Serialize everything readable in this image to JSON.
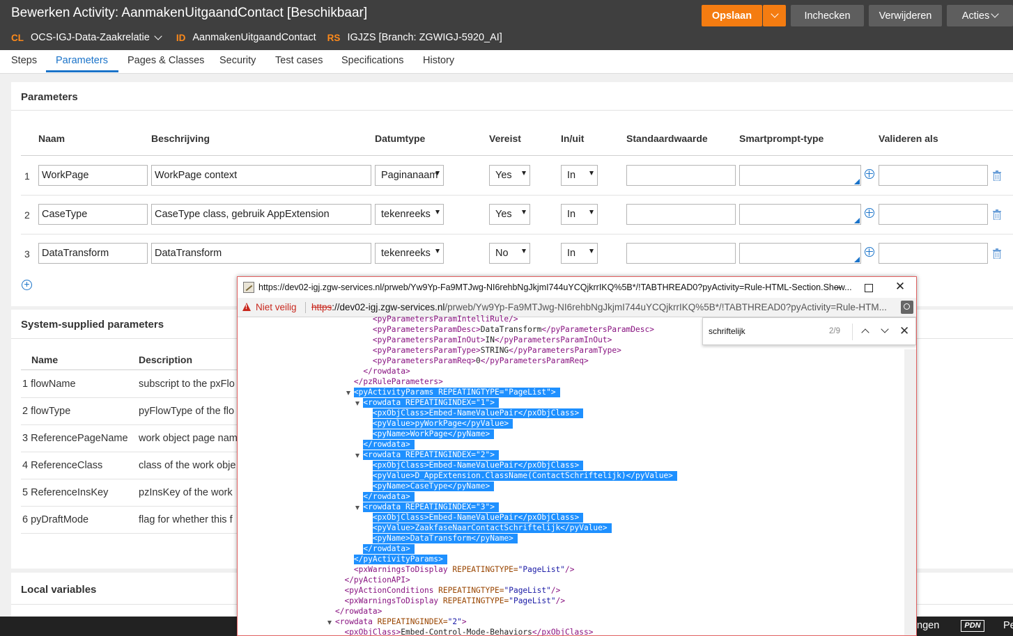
{
  "header": {
    "title": "Bewerken Activity: AanmakenUitgaandContact [Beschikbaar]",
    "cl_key": "CL",
    "cl_value": "OCS-IGJ-Data-Zaakrelatie",
    "id_key": "ID",
    "id_value": "AanmakenUitgaandContact",
    "rs_key": "RS",
    "rs_value": "IGJZS [Branch: ZGWIGJ-5920_AI]",
    "save_label": "Opslaan",
    "checkin_label": "Inchecken",
    "delete_label": "Verwijderen",
    "actions_label": "Acties"
  },
  "tabs": [
    "Steps",
    "Parameters",
    "Pages & Classes",
    "Security",
    "Test cases",
    "Specifications",
    "History"
  ],
  "parameters": {
    "title": "Parameters",
    "headers": [
      "Naam",
      "Beschrijving",
      "Datumtype",
      "Vereist",
      "In/uit",
      "Standaardwaarde",
      "Smartprompt-type",
      "Valideren als"
    ],
    "rows": [
      {
        "num": "1",
        "name": "WorkPage",
        "description": "WorkPage context",
        "type": "Paginanaam",
        "required": "Yes",
        "inout": "In",
        "default": "",
        "smartprompt": "",
        "validate": ""
      },
      {
        "num": "2",
        "name": "CaseType",
        "description": "CaseType class, gebruik AppExtension",
        "type": "tekenreeks",
        "required": "Yes",
        "inout": "In",
        "default": "",
        "smartprompt": "",
        "validate": ""
      },
      {
        "num": "3",
        "name": "DataTransform",
        "description": "DataTransform",
        "type": "tekenreeks",
        "required": "No",
        "inout": "In",
        "default": "",
        "smartprompt": "",
        "validate": ""
      }
    ]
  },
  "system": {
    "title": "System-supplied parameters",
    "headers": [
      "Name",
      "Description"
    ],
    "rows": [
      {
        "name": "1 flowName",
        "description": "subscript to the pxFlo"
      },
      {
        "name": "2 flowType",
        "description": "pyFlowType of the flo"
      },
      {
        "name": "3 ReferencePageName",
        "description": "work object page nam"
      },
      {
        "name": "4 ReferenceClass",
        "description": "class of the work obje"
      },
      {
        "name": "5 ReferenceInsKey",
        "description": "pzInsKey of the work"
      },
      {
        "name": "6 pyDraftMode",
        "description": "flag for whether this f"
      }
    ]
  },
  "local": {
    "title": "Local variables"
  },
  "bottom": {
    "lang": "ngen",
    "pdn": "PDN",
    "pe": "Pe"
  },
  "popup": {
    "window_title": "https://dev02-igj.zgw-services.nl/prweb/Yw9Yp-Fa9MTJwg-NI6rehbNgJkjmI744uYCQjkrrIKQ%5B*/!TABTHREAD0?pyActivity=Rule-HTML-Section.Show...",
    "not_secure": "Niet veilig",
    "url_scheme": "https",
    "url_host": "://dev02-igj.zgw-services.nl",
    "url_path": "/prweb/Yw9Yp-Fa9MTJwg-NI6rehbNgJkjmI744uYCQjkrrIKQ%5B*/!TABTHREAD0?pyActivity=Rule-HTM...",
    "find_text": "schriftelijk",
    "find_count": "2/9",
    "xml_lines": [
      {
        "indent": 18,
        "tag": "<pyParametersParamIntelliRule/>",
        "hl": false
      },
      {
        "indent": 18,
        "tag": "<pyParametersParamDesc>",
        "text": "DataTransform",
        "close": "</pyParametersParamDesc>",
        "hl": false
      },
      {
        "indent": 18,
        "tag": "<pyParametersParamInOut>",
        "text": "IN",
        "close": "</pyParametersParamInOut>",
        "hl": false
      },
      {
        "indent": 18,
        "tag": "<pyParametersParamType>",
        "text": "STRING",
        "close": "</pyParametersParamType>",
        "hl": false
      },
      {
        "indent": 18,
        "tag": "<pyParametersParamReq>",
        "text": "0",
        "close": "</pyParametersParamReq>",
        "hl": false
      },
      {
        "indent": 16,
        "tag": "</rowdata>",
        "hl": false
      },
      {
        "indent": 14,
        "tag": "</pzRuleParameters>",
        "hl": false
      },
      {
        "indent": 14,
        "tag": "<pyActivityParams",
        "attr": " REPEATINGTYPE=",
        "val": "\"PageList\"",
        "end": ">",
        "hl": true,
        "toggle": true
      },
      {
        "indent": 16,
        "tag": "<rowdata",
        "attr": " REPEATINGINDEX=",
        "val": "\"1\"",
        "end": ">",
        "hl": true,
        "toggle": true
      },
      {
        "indent": 18,
        "tag": "<pxObjClass>",
        "text": "Embed-NameValuePair",
        "close": "</pxObjClass>",
        "hl": true
      },
      {
        "indent": 18,
        "tag": "<pyValue>",
        "text": "pyWorkPage",
        "close": "</pyValue>",
        "hl": true
      },
      {
        "indent": 18,
        "tag": "<pyName>",
        "text": "WorkPage",
        "close": "</pyName>",
        "hl": true
      },
      {
        "indent": 16,
        "tag": "</rowdata>",
        "hl": true
      },
      {
        "indent": 16,
        "tag": "<rowdata",
        "attr": " REPEATINGINDEX=",
        "val": "\"2\"",
        "end": ">",
        "hl": true,
        "toggle": true
      },
      {
        "indent": 18,
        "tag": "<pxObjClass>",
        "text": "Embed-NameValuePair",
        "close": "</pxObjClass>",
        "hl": true
      },
      {
        "indent": 18,
        "tag": "<pyValue>",
        "text": "D_AppExtension.ClassName(ContactSchriftelijk)",
        "close": "</pyValue>",
        "hl": true
      },
      {
        "indent": 18,
        "tag": "<pyName>",
        "text": "CaseType",
        "close": "</pyName>",
        "hl": true
      },
      {
        "indent": 16,
        "tag": "</rowdata>",
        "hl": true
      },
      {
        "indent": 16,
        "tag": "<rowdata",
        "attr": " REPEATINGINDEX=",
        "val": "\"3\"",
        "end": ">",
        "hl": true,
        "toggle": true
      },
      {
        "indent": 18,
        "tag": "<pxObjClass>",
        "text": "Embed-NameValuePair",
        "close": "</pxObjClass>",
        "hl": true
      },
      {
        "indent": 18,
        "tag": "<pyValue>",
        "text": "ZaakfaseNaarContactSchriftelijk",
        "close": "</pyValue>",
        "hl": true
      },
      {
        "indent": 18,
        "tag": "<pyName>",
        "text": "DataTransform",
        "close": "</pyName>",
        "hl": true
      },
      {
        "indent": 16,
        "tag": "</rowdata>",
        "hl": true
      },
      {
        "indent": 14,
        "tag": "</pyActivityParams>",
        "hl": true
      },
      {
        "indent": 14,
        "tag": "<pxWarningsToDisplay",
        "attr": " REPEATINGTYPE=",
        "val": "\"PageList\"",
        "end": "/>",
        "hl": false
      },
      {
        "indent": 12,
        "tag": "</pyActionAPI>",
        "hl": false
      },
      {
        "indent": 12,
        "tag": "<pyActionConditions",
        "attr": " REPEATINGTYPE=",
        "val": "\"PageList\"",
        "end": "/>",
        "hl": false
      },
      {
        "indent": 12,
        "tag": "<pxWarningsToDisplay",
        "attr": " REPEATINGTYPE=",
        "val": "\"PageList\"",
        "end": "/>",
        "hl": false
      },
      {
        "indent": 10,
        "tag": "</rowdata>",
        "hl": false
      },
      {
        "indent": 10,
        "tag": "<rowdata",
        "attr": " REPEATINGINDEX=",
        "val": "\"2\"",
        "end": ">",
        "hl": false,
        "toggle": true
      },
      {
        "indent": 12,
        "tag": "<pxObjClass>",
        "text": "Embed-Control-Mode-Behaviors",
        "close": "</pxObjClass>",
        "hl": false
      }
    ]
  }
}
